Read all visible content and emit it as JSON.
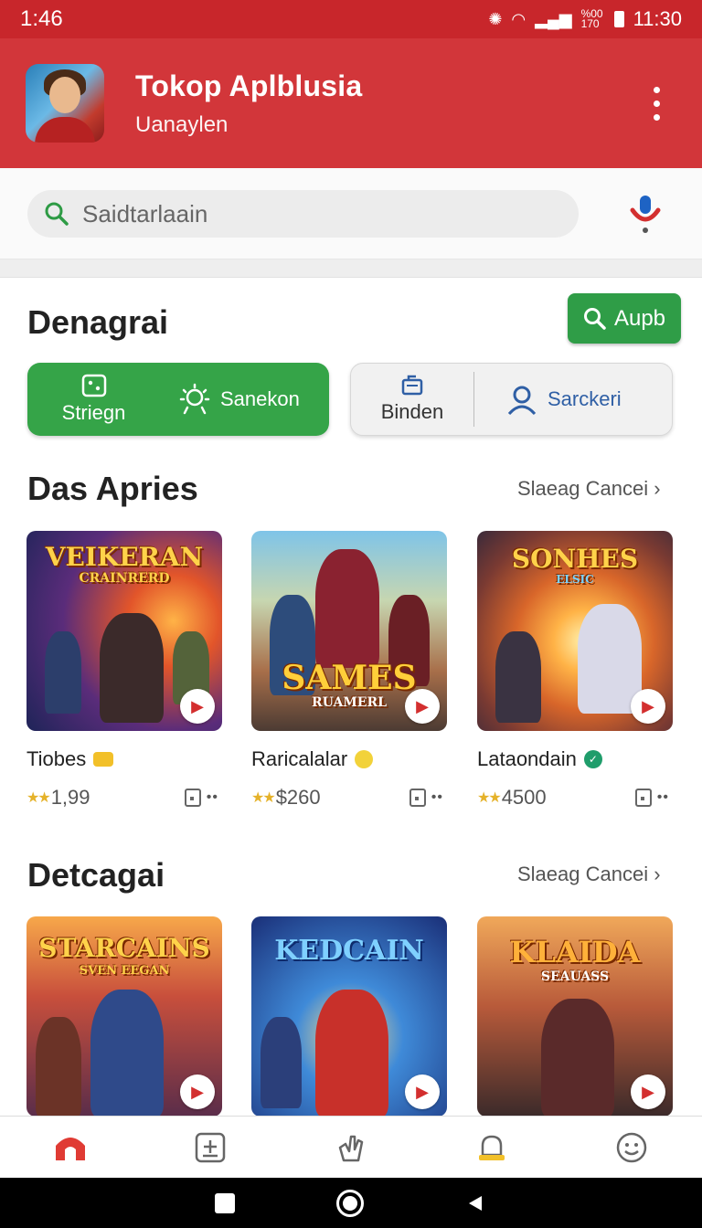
{
  "status_bar": {
    "time_left": "1:46",
    "time_right": "11:30",
    "battery_text": "%00 170"
  },
  "header": {
    "title": "Tokop Aplblusia",
    "subtitle": "Uanaylen"
  },
  "search": {
    "placeholder": "Saidtarlaain"
  },
  "section1": {
    "title": "Denagrai",
    "action_label": "Aupb",
    "pills_green": [
      {
        "label": "Striegn"
      },
      {
        "label": "Sanekon"
      }
    ],
    "pills_grey": [
      {
        "label": "Binden"
      },
      {
        "label": "Sarckeri"
      }
    ]
  },
  "section2": {
    "title": "Das Apries",
    "see_all": "Slaeag  Cancei ›",
    "cards": [
      {
        "name": "Tiobes",
        "rating": "1,99",
        "art_title": "VEIKERAN",
        "art_sub": "CRAINRERD",
        "badge": "coin"
      },
      {
        "name": "Raricalalar",
        "rating": "$260",
        "art_title": "SAMES",
        "art_sub": "RUAMERL",
        "badge": "emoji"
      },
      {
        "name": "Lataondain",
        "rating": "4500",
        "art_title": "SONHES",
        "art_sub": "ELSIC",
        "badge": "verified"
      }
    ]
  },
  "section3": {
    "title": "Detcagai",
    "see_all": "Slaeag  Cancei ›",
    "cards": [
      {
        "art_title": "STARCAINS",
        "art_sub": "SVEN EEGAN"
      },
      {
        "art_title": "KEDCAIN",
        "art_sub": ""
      },
      {
        "art_title": "KLAIDA",
        "art_sub": "SEAUASS"
      }
    ]
  },
  "colors": {
    "brand_red": "#d2363a",
    "accent_green": "#35a448"
  },
  "bottom_nav": [
    "home-icon",
    "add-box-icon",
    "hand-icon",
    "bell-icon",
    "smile-icon"
  ]
}
